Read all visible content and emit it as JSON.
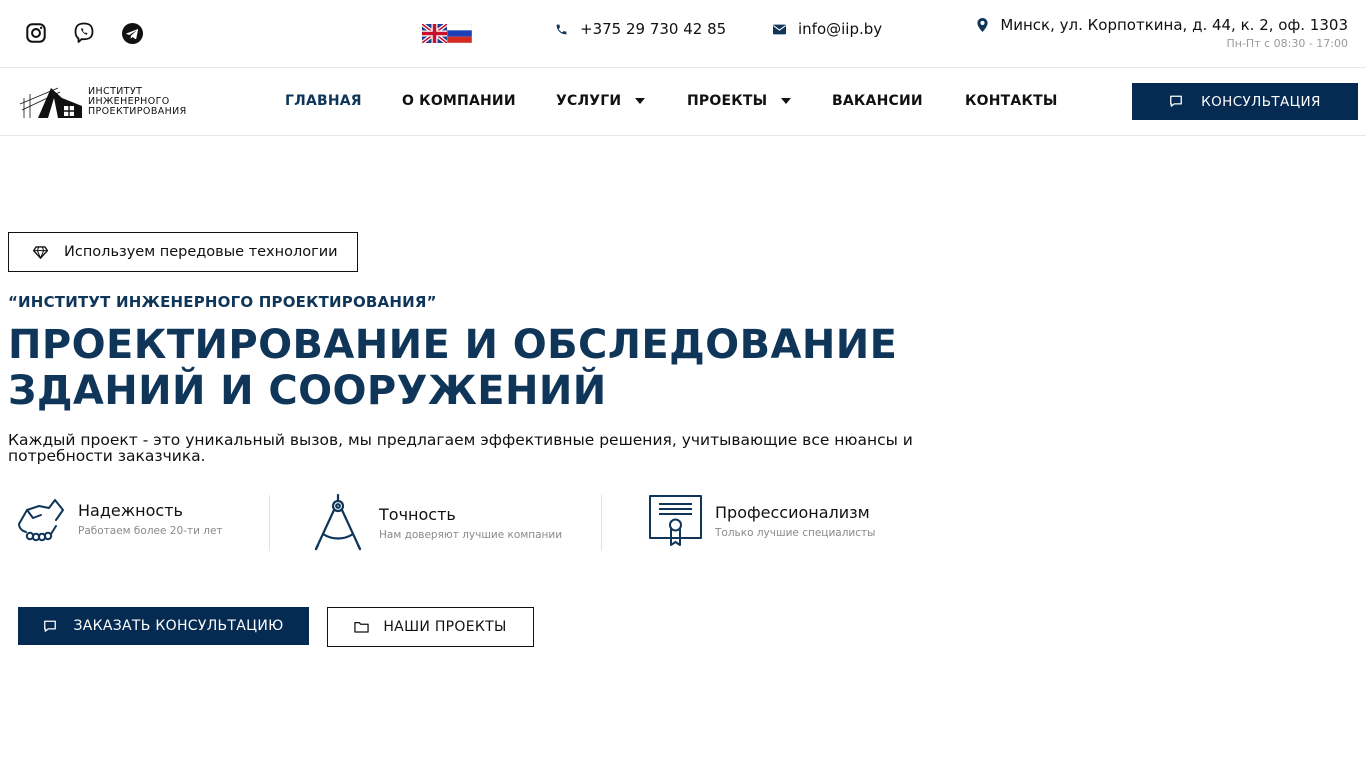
{
  "topbar": {
    "social": [
      {
        "icon": "instagram-icon"
      },
      {
        "icon": "viber-icon"
      },
      {
        "icon": "telegram-icon"
      }
    ],
    "languages": [
      {
        "icon": "uk-flag-icon"
      },
      {
        "icon": "russia-flag-icon"
      }
    ],
    "phone": "+375 29 730 42 85",
    "email": "info@iip.by",
    "address": "Минск, ул. Корпоткина, д. 44, к. 2, оф. 1303",
    "hours": "Пн-Пт с 08:30 - 17:00"
  },
  "nav": {
    "logo_lines": [
      "ИНСТИТУТ",
      "ИНЖЕНЕРНОГО",
      "ПРОЕКТИРОВАНИЯ"
    ],
    "items": [
      {
        "label": "ГЛАВНАЯ",
        "active": true
      },
      {
        "label": "О КОМПАНИИ"
      },
      {
        "label": "УСЛУГИ",
        "dropdown": true
      },
      {
        "label": "ПРОЕКТЫ",
        "dropdown": true
      },
      {
        "label": "ВАКАНСИИ"
      },
      {
        "label": "КОНТАКТЫ"
      }
    ],
    "cta_label": "КОНСУЛЬТАЦИЯ"
  },
  "hero": {
    "tag": "Используем передовые технологии",
    "subtitle": "“ИНСТИТУТ ИНЖЕНЕРНОГО ПРОЕКТИРОВАНИЯ”",
    "headline_line1": "ПРОЕКТИРОВАНИЕ И ОБСЛЕДОВАНИЕ",
    "headline_line2": "ЗДАНИЙ И СООРУЖЕНИЙ",
    "lead": "Каждый проект - это уникальный вызов, мы предлагаем эффективные решения, учитывающие все нюансы и потребности заказчика.",
    "features": [
      {
        "title": "Надежность",
        "desc": "Работаем более 20-ти лет",
        "icon": "handshake-icon"
      },
      {
        "title": "Точность",
        "desc": "Нам доверяют лучшие компании",
        "icon": "compass-icon"
      },
      {
        "title": "Профессионализм",
        "desc": "Только лучшие специалисты",
        "icon": "certificate-icon"
      }
    ],
    "primary_button": "ЗАКАЗАТЬ КОНСУЛЬТАЦИЮ",
    "secondary_button": "НАШИ ПРОЕКТЫ"
  },
  "colors": {
    "brand_dark": "#062b52",
    "heading": "#0f3559",
    "muted": "#8a8a8a"
  }
}
